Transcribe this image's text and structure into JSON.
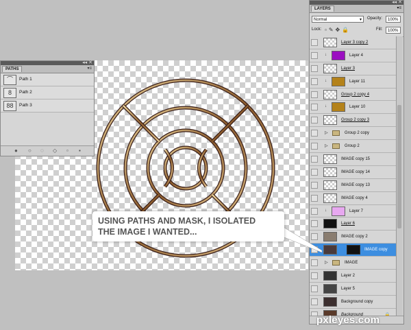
{
  "paths_panel": {
    "tab": "PATHS",
    "items": [
      {
        "label": "Path 1"
      },
      {
        "label": "Path 2"
      },
      {
        "label": "Path 3"
      }
    ]
  },
  "layers_panel": {
    "tab": "LAYERS",
    "blend_mode": "Normal",
    "opacity_label": "Opacity:",
    "opacity_value": "100%",
    "lock_label": "Lock:",
    "fill_label": "Fill:",
    "fill_value": "100%",
    "layers": [
      {
        "name": "Layer 3 copy 2",
        "thumb": "checker",
        "style": "u"
      },
      {
        "name": "Layer 4",
        "thumb": "#9b0fc1",
        "clip": true
      },
      {
        "name": "Layer 3",
        "thumb": "checker",
        "style": "u"
      },
      {
        "name": "Layer 11",
        "thumb": "#b4821a",
        "clip": true
      },
      {
        "name": "Group 2 copy 4",
        "thumb": "checker",
        "style": "u"
      },
      {
        "name": "Layer 10",
        "thumb": "#b4821a",
        "clip": true
      },
      {
        "name": "Group 2 copy 3",
        "thumb": "checker",
        "style": "u"
      },
      {
        "name": "Group 2 copy",
        "group": true
      },
      {
        "name": "Group 2",
        "group": true
      },
      {
        "name": "IMAGE copy 15",
        "thumb": "checker"
      },
      {
        "name": "IMAGE copy 14",
        "thumb": "checker"
      },
      {
        "name": "IMAGE copy 13",
        "thumb": "checker"
      },
      {
        "name": "IMAGE copy 4",
        "thumb": "checker"
      },
      {
        "name": "Layer 7",
        "thumb": "#e7a8f0",
        "clip": true
      },
      {
        "name": "Layer 6",
        "thumb": "#111111",
        "style": "u"
      },
      {
        "name": "IMAGE copy 2",
        "thumb": "#8a7d70"
      },
      {
        "name": "IMAGE copy",
        "thumb": "#4a3a3a",
        "selected": true,
        "mask": true
      },
      {
        "name": "IMAGE",
        "group": true
      },
      {
        "name": "Layer 2",
        "thumb": "#333333"
      },
      {
        "name": "Layer 5",
        "thumb": "#444444"
      },
      {
        "name": "Background copy",
        "thumb": "#3c2f2f"
      },
      {
        "name": "Background",
        "thumb": "#5a3a2a",
        "style": "i",
        "locked": true
      }
    ]
  },
  "callout": {
    "line1": "USING PATHS AND MASK, I ISOLATED",
    "line2": "THE IMAGE I WANTED..."
  },
  "watermark": "pxleyes.com",
  "colors": {
    "selected": "#3d8ee0",
    "gold": "#c8a050",
    "canvas_bg": "#c0c0c0"
  }
}
